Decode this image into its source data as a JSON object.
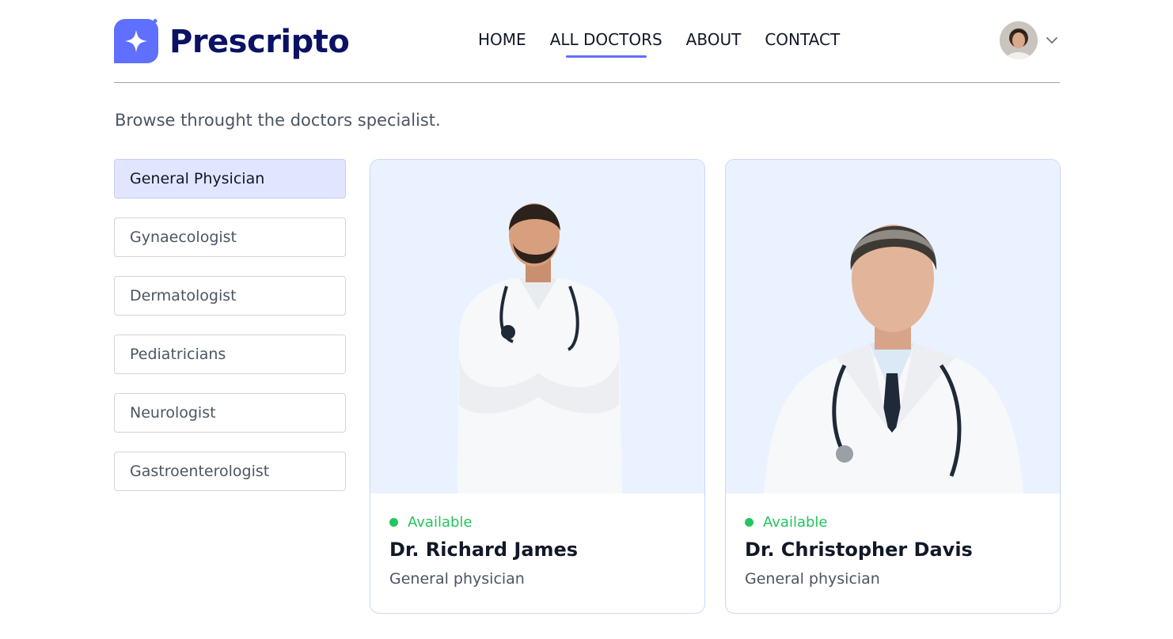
{
  "brand": {
    "name": "Prescripto",
    "color": "#5f6fff",
    "text_color": "#0b1264"
  },
  "nav": {
    "links": [
      {
        "label": "HOME",
        "active": false
      },
      {
        "label": "ALL DOCTORS",
        "active": true
      },
      {
        "label": "ABOUT",
        "active": false
      },
      {
        "label": "CONTACT",
        "active": false
      }
    ],
    "profile_icon": "user-avatar",
    "dropdown_icon": "chevron-down-icon"
  },
  "page": {
    "subtitle": "Browse throught the doctors specialist."
  },
  "filters": [
    {
      "label": "General Physician",
      "active": true
    },
    {
      "label": "Gynaecologist",
      "active": false
    },
    {
      "label": "Dermatologist",
      "active": false
    },
    {
      "label": "Pediatricians",
      "active": false
    },
    {
      "label": "Neurologist",
      "active": false
    },
    {
      "label": "Gastroenterologist",
      "active": false
    }
  ],
  "doctors": [
    {
      "status": "Available",
      "name": "Dr. Richard James",
      "speciality": "General physician"
    },
    {
      "status": "Available",
      "name": "Dr. Christopher Davis",
      "speciality": "General physician"
    }
  ],
  "colors": {
    "available": "#22c55e",
    "active_filter_bg": "#e2e5ff",
    "card_bg": "#eaf2ff"
  }
}
